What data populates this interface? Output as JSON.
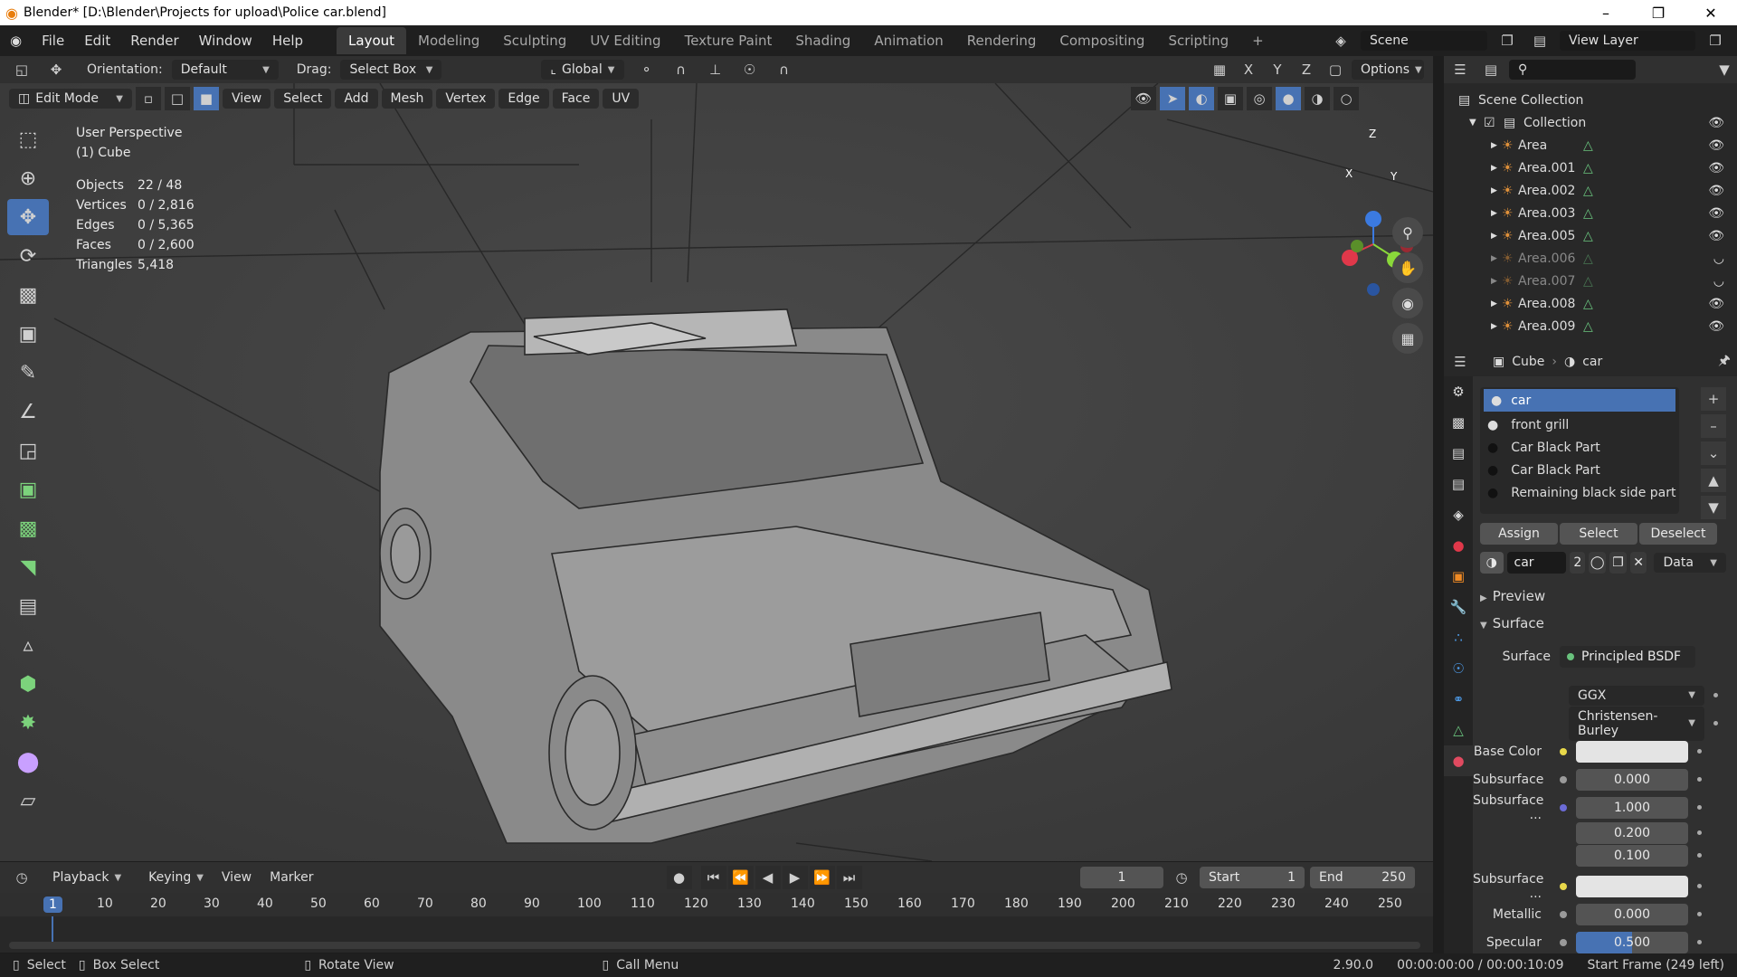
{
  "titlebar": {
    "title": "Blender* [D:\\Blender\\Projects for upload\\Police car.blend]"
  },
  "menu": [
    "File",
    "Edit",
    "Render",
    "Window",
    "Help"
  ],
  "workspaces": [
    "Layout",
    "Modeling",
    "Sculpting",
    "UV Editing",
    "Texture Paint",
    "Shading",
    "Animation",
    "Rendering",
    "Compositing",
    "Scripting",
    "+"
  ],
  "scene": {
    "label": "Scene",
    "view_layer": "View Layer"
  },
  "header": {
    "orientation_label": "Orientation:",
    "orientation_value": "Default",
    "drag_label": "Drag:",
    "drag_value": "Select Box",
    "transform_orientation": "Global",
    "options": "Options"
  },
  "mode_bar": {
    "mode": "Edit Mode",
    "menus": [
      "View",
      "Select",
      "Add",
      "Mesh",
      "Vertex",
      "Edge",
      "Face",
      "UV"
    ]
  },
  "viewport": {
    "perspective": "User Perspective",
    "object": "(1) Cube",
    "stats": [
      {
        "k": "Objects",
        "v": "22 / 48"
      },
      {
        "k": "Vertices",
        "v": "0 / 2,816"
      },
      {
        "k": "Edges",
        "v": "0 / 5,365"
      },
      {
        "k": "Faces",
        "v": "0 / 2,600"
      },
      {
        "k": "Triangles",
        "v": "5,418"
      }
    ],
    "gizmo_axes": {
      "x": "X",
      "y": "Y",
      "z": "Z"
    }
  },
  "outliner": {
    "root": "Scene Collection",
    "collection": "Collection",
    "items": [
      {
        "name": "Area",
        "visible": true
      },
      {
        "name": "Area.001",
        "visible": true
      },
      {
        "name": "Area.002",
        "visible": true
      },
      {
        "name": "Area.003",
        "visible": true
      },
      {
        "name": "Area.005",
        "visible": true
      },
      {
        "name": "Area.006",
        "visible": false
      },
      {
        "name": "Area.007",
        "visible": false
      },
      {
        "name": "Area.008",
        "visible": true
      },
      {
        "name": "Area.009",
        "visible": true
      }
    ]
  },
  "properties": {
    "object": "Cube",
    "material": "car",
    "slots": [
      "car",
      "front grill",
      "Car Black Part",
      "Car Black Part",
      "Remaining black side part"
    ],
    "assign": "Assign",
    "select": "Select",
    "deselect": "Deselect",
    "mat_name": "car",
    "users": "2",
    "link": "Data",
    "preview": "Preview",
    "surface_section": "Surface",
    "surface_label": "Surface",
    "surface_value": "Principled BSDF",
    "distribution": "GGX",
    "subsurface_method": "Christensen-Burley",
    "base_color_label": "Base Color",
    "subsurface_label": "Subsurface",
    "subsurface_value": "0.000",
    "subsurface_radius_label": "Subsurface ...",
    "radius": [
      "1.000",
      "0.200",
      "0.100"
    ],
    "subsurface_color_label": "Subsurface ...",
    "metallic_label": "Metallic",
    "metallic_value": "0.000",
    "specular_label": "Specular",
    "specular_value": "0.500"
  },
  "timeline": {
    "menus": [
      "Playback",
      "Keying",
      "View",
      "Marker"
    ],
    "current_frame": "1",
    "start_label": "Start",
    "start": "1",
    "end_label": "End",
    "end": "250",
    "ticks": [
      "1",
      "10",
      "20",
      "30",
      "40",
      "50",
      "60",
      "70",
      "80",
      "90",
      "100",
      "110",
      "120",
      "130",
      "140",
      "150",
      "160",
      "170",
      "180",
      "190",
      "200",
      "210",
      "220",
      "230",
      "240",
      "250"
    ]
  },
  "statusbar": {
    "select": "Select",
    "box_select": "Box Select",
    "rotate": "Rotate View",
    "call_menu": "Call Menu",
    "version": "2.90.0",
    "time": "00:00:00:00 / 00:00:10:09",
    "frame": "Start Frame (249 left)"
  }
}
